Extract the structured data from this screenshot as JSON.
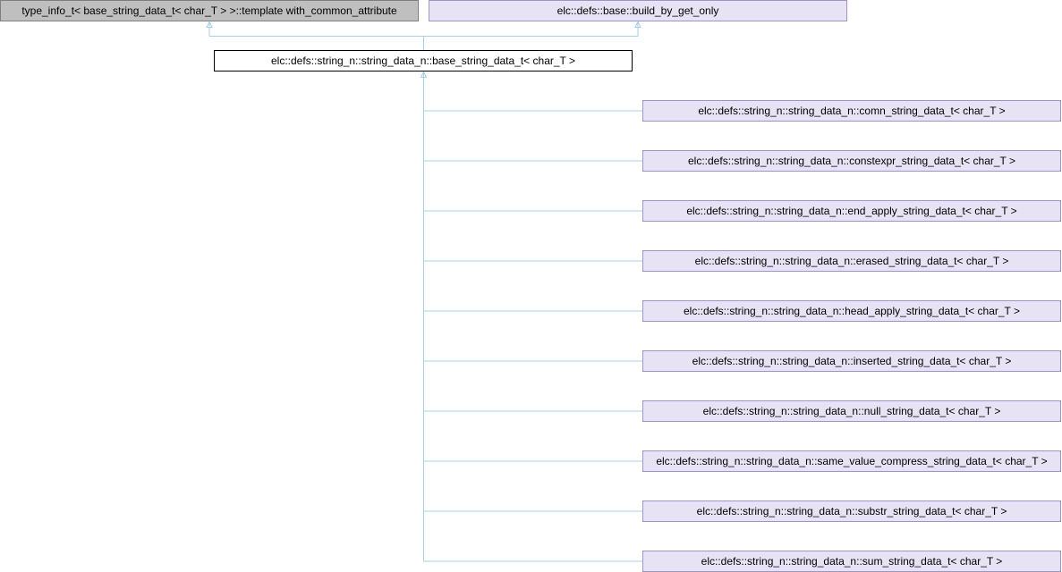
{
  "colors": {
    "edge": "#a5cfe6",
    "bases_fill": "#bfbfbf",
    "bases_stroke": "#7f7f7f",
    "link_fill": "#e8e2f5",
    "link_stroke": "#9e92c8",
    "current_fill": "#ffffff",
    "current_stroke": "#000000"
  },
  "diagram": {
    "base_classes": [
      {
        "label": "type_info_t< base_string_data_t< char_T > >::template with_common_attribute",
        "kind": "external"
      },
      {
        "label": "elc::defs::base::build_by_get_only",
        "kind": "link"
      }
    ],
    "current_class": {
      "label": "elc::defs::string_n::string_data_n::base_string_data_t< char_T >"
    },
    "derived_classes": [
      {
        "label": "elc::defs::string_n::string_data_n::comn_string_data_t< char_T >"
      },
      {
        "label": "elc::defs::string_n::string_data_n::constexpr_string_data_t< char_T >"
      },
      {
        "label": "elc::defs::string_n::string_data_n::end_apply_string_data_t< char_T >"
      },
      {
        "label": "elc::defs::string_n::string_data_n::erased_string_data_t< char_T >"
      },
      {
        "label": "elc::defs::string_n::string_data_n::head_apply_string_data_t< char_T >"
      },
      {
        "label": "elc::defs::string_n::string_data_n::inserted_string_data_t< char_T >"
      },
      {
        "label": "elc::defs::string_n::string_data_n::null_string_data_t< char_T >"
      },
      {
        "label": "elc::defs::string_n::string_data_n::same_value_compress_string_data_t< char_T >"
      },
      {
        "label": "elc::defs::string_n::string_data_n::substr_string_data_t< char_T >"
      },
      {
        "label": "elc::defs::string_n::string_data_n::sum_string_data_t< char_T >"
      }
    ]
  }
}
